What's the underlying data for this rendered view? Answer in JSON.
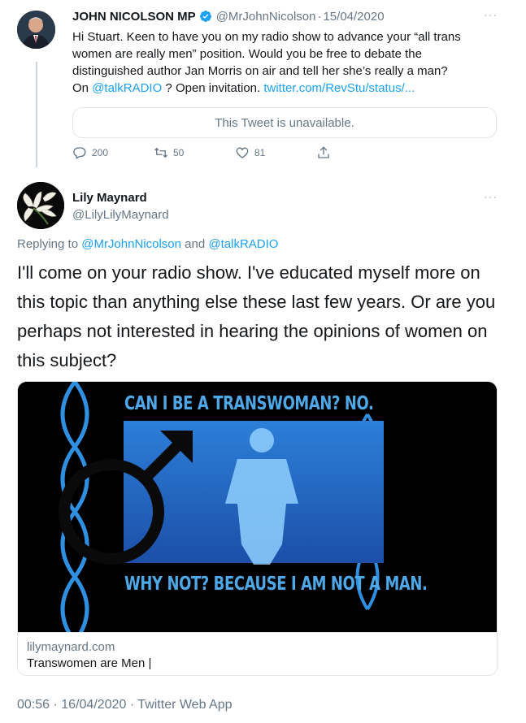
{
  "tweet1": {
    "author_name": "JOHN NICOLSON MP",
    "handle": "@MrJohnNicolson",
    "date": "15/04/2020",
    "separator": "·",
    "more": "···",
    "body_lines": [
      "Hi Stuart. Keen to have you on my radio show to advance your “all trans",
      "women are really men” position. Would you be free to debate the",
      "distinguished author Jan Morris on air and tell her she’s really a man?"
    ],
    "body_last_prefix": "On ",
    "body_last_mention": "@talkRADIO",
    "body_last_middle": " ? Open invitation. ",
    "body_last_link": "twitter.com/RevStu/status/...",
    "quote_unavailable": "This Tweet is unavailable.",
    "replies": "200",
    "retweets": "50",
    "likes": "81"
  },
  "tweet2": {
    "author_name": "Lily Maynard",
    "handle": "@LilyLilyMaynard",
    "more": "···",
    "replying_prefix": "Replying to ",
    "replying_user1": "@MrJohnNicolson",
    "replying_and": " and ",
    "replying_user2": "@talkRADIO",
    "body_lines": [
      "I'll come on your radio show. I've educated myself more on",
      "this topic than anything else these last few years. Or are you",
      "perhaps not interested in hearing the opinions of women on",
      "this subject?"
    ],
    "card": {
      "image_headline_top": "CAN I BE A TRANSWOMAN? NO.",
      "image_headline_bottom": "WHY NOT? BECAUSE I AM NOT A MAN.",
      "domain": "lilymaynard.com",
      "title": "Transwomen are Men |"
    },
    "time": "00:56",
    "date": "16/04/2020",
    "separator": "·",
    "source": "Twitter Web App"
  },
  "colors": {
    "accent": "#1da1f2",
    "verified": "#1da1f2",
    "muted": "#657786",
    "image_blue": "#2f8fe0"
  }
}
